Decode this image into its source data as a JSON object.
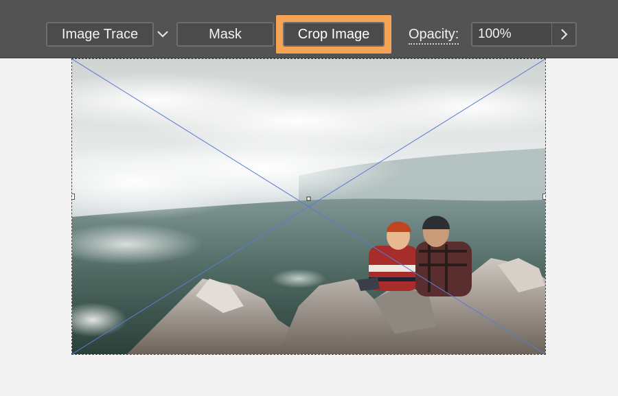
{
  "toolbar": {
    "image_trace_label": "Image Trace",
    "mask_label": "Mask",
    "crop_image_label": "Crop Image",
    "opacity_label": "Opacity:",
    "opacity_value": "100%",
    "highlight_color": "#f5a455"
  },
  "canvas": {
    "image_subject": "couple sitting on mountain rocks above clouds",
    "selection_line_color": "#5a7bd6"
  }
}
